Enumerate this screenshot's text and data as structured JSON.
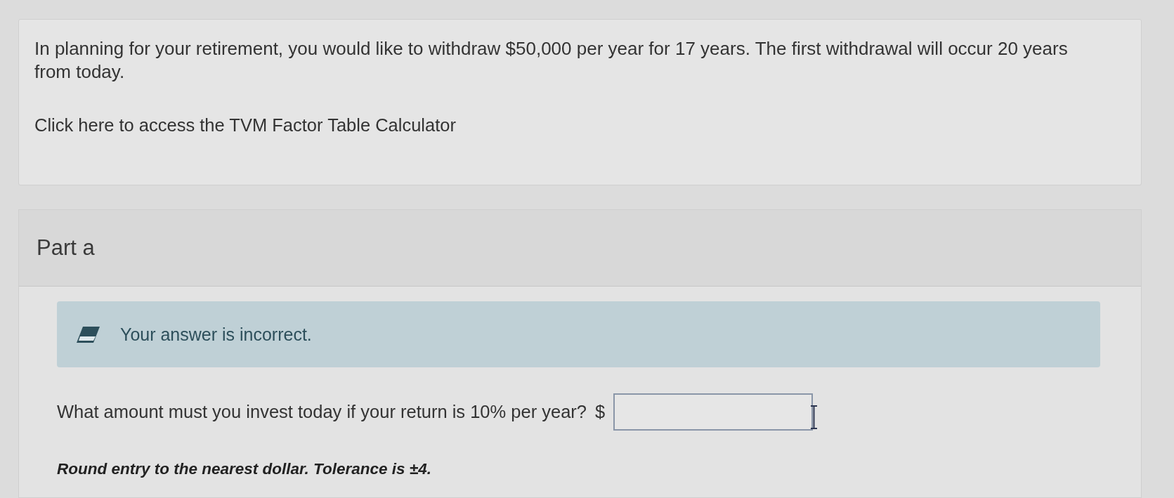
{
  "problem": {
    "statement": "In planning for your retirement, you would like to withdraw $50,000 per year for 17 years. The first withdrawal will occur 20 years from today.",
    "link": "Click here to access the TVM Factor Table Calculator"
  },
  "part": {
    "title": "Part a",
    "feedback": {
      "kind": "incorrect",
      "message": "Your answer is incorrect."
    },
    "question": {
      "prompt": "What amount must you invest today if your return is 10% per year?",
      "currency": "$"
    },
    "hint": "Round entry to the nearest dollar. Tolerance is ±4."
  }
}
